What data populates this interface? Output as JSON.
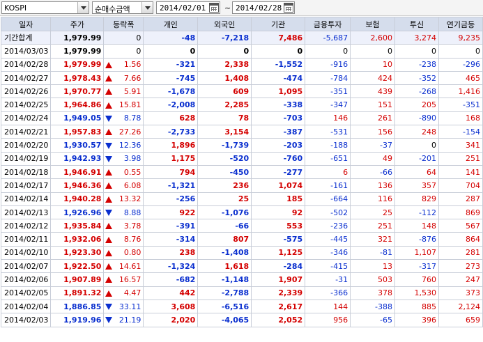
{
  "toolbar": {
    "index_select": "KOSPI",
    "mode_select": "순매수금액",
    "start_date": "2014/02/01",
    "end_date": "2014/02/28",
    "range_sep": "~"
  },
  "columns": [
    "일자",
    "주가",
    "등락폭",
    "개인",
    "외국인",
    "기관",
    "금융투자",
    "보험",
    "투신",
    "연기금등"
  ],
  "rows": [
    {
      "date": "기간합계",
      "price": "1,979.99",
      "dir": "none",
      "chg": "0",
      "indv": "-48",
      "frgn": "-7,218",
      "inst": "7,486",
      "fin": "-5,687",
      "ins": "2,600",
      "trust": "3,274",
      "pension": "9,235",
      "kind": "total"
    },
    {
      "date": "2014/03/03",
      "price": "1,979.99",
      "dir": "none",
      "chg": "0",
      "indv": "0",
      "frgn": "0",
      "inst": "0",
      "fin": "0",
      "ins": "0",
      "trust": "0",
      "pension": "0",
      "kind": "flat"
    },
    {
      "date": "2014/02/28",
      "price": "1,979.99",
      "dir": "up",
      "chg": "1.56",
      "indv": "-321",
      "frgn": "2,338",
      "inst": "-1,552",
      "fin": "-916",
      "ins": "10",
      "trust": "-238",
      "pension": "-296"
    },
    {
      "date": "2014/02/27",
      "price": "1,978.43",
      "dir": "up",
      "chg": "7.66",
      "indv": "-745",
      "frgn": "1,408",
      "inst": "-474",
      "fin": "-784",
      "ins": "424",
      "trust": "-352",
      "pension": "465"
    },
    {
      "date": "2014/02/26",
      "price": "1,970.77",
      "dir": "up",
      "chg": "5.91",
      "indv": "-1,678",
      "frgn": "609",
      "inst": "1,095",
      "fin": "-351",
      "ins": "439",
      "trust": "-268",
      "pension": "1,416"
    },
    {
      "date": "2014/02/25",
      "price": "1,964.86",
      "dir": "up",
      "chg": "15.81",
      "indv": "-2,008",
      "frgn": "2,285",
      "inst": "-338",
      "fin": "-347",
      "ins": "151",
      "trust": "205",
      "pension": "-351"
    },
    {
      "date": "2014/02/24",
      "price": "1,949.05",
      "dir": "down",
      "chg": "8.78",
      "indv": "628",
      "frgn": "78",
      "inst": "-703",
      "fin": "146",
      "ins": "261",
      "trust": "-890",
      "pension": "168"
    },
    {
      "date": "2014/02/21",
      "price": "1,957.83",
      "dir": "up",
      "chg": "27.26",
      "indv": "-2,733",
      "frgn": "3,154",
      "inst": "-387",
      "fin": "-531",
      "ins": "156",
      "trust": "248",
      "pension": "-154"
    },
    {
      "date": "2014/02/20",
      "price": "1,930.57",
      "dir": "down",
      "chg": "12.36",
      "indv": "1,896",
      "frgn": "-1,739",
      "inst": "-203",
      "fin": "-188",
      "ins": "-37",
      "trust": "0",
      "pension": "341"
    },
    {
      "date": "2014/02/19",
      "price": "1,942.93",
      "dir": "down",
      "chg": "3.98",
      "indv": "1,175",
      "frgn": "-520",
      "inst": "-760",
      "fin": "-651",
      "ins": "49",
      "trust": "-201",
      "pension": "251"
    },
    {
      "date": "2014/02/18",
      "price": "1,946.91",
      "dir": "up",
      "chg": "0.55",
      "indv": "794",
      "frgn": "-450",
      "inst": "-277",
      "fin": "6",
      "ins": "-66",
      "trust": "64",
      "pension": "141"
    },
    {
      "date": "2014/02/17",
      "price": "1,946.36",
      "dir": "up",
      "chg": "6.08",
      "indv": "-1,321",
      "frgn": "236",
      "inst": "1,074",
      "fin": "-161",
      "ins": "136",
      "trust": "357",
      "pension": "704"
    },
    {
      "date": "2014/02/14",
      "price": "1,940.28",
      "dir": "up",
      "chg": "13.32",
      "indv": "-256",
      "frgn": "25",
      "inst": "185",
      "fin": "-664",
      "ins": "116",
      "trust": "829",
      "pension": "287"
    },
    {
      "date": "2014/02/13",
      "price": "1,926.96",
      "dir": "down",
      "chg": "8.88",
      "indv": "922",
      "frgn": "-1,076",
      "inst": "92",
      "fin": "-502",
      "ins": "25",
      "trust": "-112",
      "pension": "869"
    },
    {
      "date": "2014/02/12",
      "price": "1,935.84",
      "dir": "up",
      "chg": "3.78",
      "indv": "-391",
      "frgn": "-66",
      "inst": "553",
      "fin": "-236",
      "ins": "251",
      "trust": "148",
      "pension": "567"
    },
    {
      "date": "2014/02/11",
      "price": "1,932.06",
      "dir": "up",
      "chg": "8.76",
      "indv": "-314",
      "frgn": "807",
      "inst": "-575",
      "fin": "-445",
      "ins": "321",
      "trust": "-876",
      "pension": "864"
    },
    {
      "date": "2014/02/10",
      "price": "1,923.30",
      "dir": "up",
      "chg": "0.80",
      "indv": "238",
      "frgn": "-1,408",
      "inst": "1,125",
      "fin": "-346",
      "ins": "-81",
      "trust": "1,107",
      "pension": "281"
    },
    {
      "date": "2014/02/07",
      "price": "1,922.50",
      "dir": "up",
      "chg": "14.61",
      "indv": "-1,324",
      "frgn": "1,618",
      "inst": "-284",
      "fin": "-415",
      "ins": "13",
      "trust": "-317",
      "pension": "273"
    },
    {
      "date": "2014/02/06",
      "price": "1,907.89",
      "dir": "up",
      "chg": "16.57",
      "indv": "-682",
      "frgn": "-1,148",
      "inst": "1,907",
      "fin": "-31",
      "ins": "503",
      "trust": "760",
      "pension": "247"
    },
    {
      "date": "2014/02/05",
      "price": "1,891.32",
      "dir": "up",
      "chg": "4.47",
      "indv": "442",
      "frgn": "-2,788",
      "inst": "2,339",
      "fin": "-366",
      "ins": "378",
      "trust": "1,530",
      "pension": "373"
    },
    {
      "date": "2014/02/04",
      "price": "1,886.85",
      "dir": "down",
      "chg": "33.11",
      "indv": "3,608",
      "frgn": "-6,516",
      "inst": "2,617",
      "fin": "144",
      "ins": "-388",
      "trust": "885",
      "pension": "2,124"
    },
    {
      "date": "2014/02/03",
      "price": "1,919.96",
      "dir": "down",
      "chg": "21.19",
      "indv": "2,020",
      "frgn": "-4,065",
      "inst": "2,052",
      "fin": "956",
      "ins": "-65",
      "trust": "396",
      "pension": "659"
    }
  ],
  "colors": {
    "up": "#d40000",
    "down": "#0a2fcf",
    "header_bg": "#d5ddec",
    "total_bg": "#eef1fb"
  }
}
